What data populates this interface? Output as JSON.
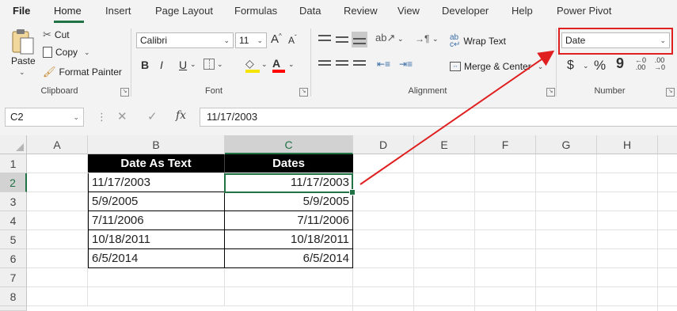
{
  "menu": {
    "tabs": [
      "File",
      "Home",
      "Insert",
      "Page Layout",
      "Formulas",
      "Data",
      "Review",
      "View",
      "Developer",
      "Help",
      "Power Pivot"
    ],
    "active": "Home"
  },
  "clipboard": {
    "paste": "Paste",
    "cut": "Cut",
    "copy": "Copy",
    "format_painter": "Format Painter",
    "label": "Clipboard"
  },
  "font": {
    "name": "Calibri",
    "size": "11",
    "bold": "B",
    "italic": "I",
    "underline": "U",
    "grow": "A",
    "shrink": "A",
    "label": "Font"
  },
  "alignment": {
    "wrap_text": "Wrap Text",
    "merge_center": "Merge & Center",
    "label": "Alignment"
  },
  "number": {
    "format": "Date",
    "currency": "$",
    "percent": "%",
    "comma": "9",
    "label": "Number"
  },
  "formula_bar": {
    "name_box": "C2",
    "fx": "fx",
    "cancel": "✕",
    "enter": "✓",
    "formula": "11/17/2003"
  },
  "grid": {
    "columns": [
      "A",
      "B",
      "C",
      "D",
      "E",
      "F",
      "G",
      "H"
    ],
    "rows": [
      "1",
      "2",
      "3",
      "4",
      "5",
      "6",
      "7",
      "8"
    ],
    "headers": [
      "Date As Text",
      "Dates"
    ],
    "text_dates": [
      "11/17/2003",
      "5/9/2005",
      "7/11/2006",
      "10/18/2011",
      "6/5/2014"
    ],
    "dates": [
      "11/17/2003",
      "5/9/2005",
      "7/11/2006",
      "10/18/2011",
      "6/5/2014"
    ],
    "selected_column": "C",
    "selected_row": "2"
  },
  "colors": {
    "accent": "#217346",
    "annotation": "#e02020"
  }
}
